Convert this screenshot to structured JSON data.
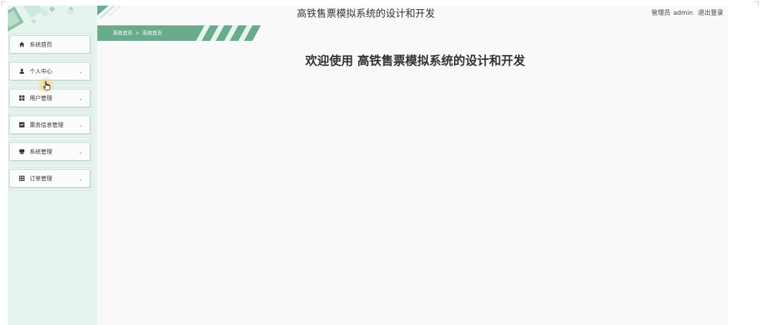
{
  "header": {
    "app_title": "高铁售票模拟系统的设计和开发",
    "user_role": "管理员",
    "username": "admin",
    "logout_label": "退出登录"
  },
  "breadcrumb": {
    "items": [
      "系统首页",
      "系统首页"
    ],
    "separator": ">"
  },
  "main": {
    "welcome_text": "欢迎使用 高铁售票模拟系统的设计和开发"
  },
  "sidebar": {
    "items": [
      {
        "label": "系统首页",
        "icon": "home-icon",
        "has_submenu": false
      },
      {
        "label": "个人中心",
        "icon": "person-icon",
        "has_submenu": true
      },
      {
        "label": "用户管理",
        "icon": "grid-icon",
        "has_submenu": true
      },
      {
        "label": "票务信息管理",
        "icon": "ticket-icon",
        "has_submenu": true
      },
      {
        "label": "系统管理",
        "icon": "system-icon",
        "has_submenu": true
      },
      {
        "label": "订单管理",
        "icon": "table-icon",
        "has_submenu": true
      }
    ],
    "chevron": "⌄"
  },
  "colors": {
    "accent": "#6aab8e",
    "sidebar_bg": "#e6f4ee",
    "page_bg": "#f9f9f9"
  }
}
